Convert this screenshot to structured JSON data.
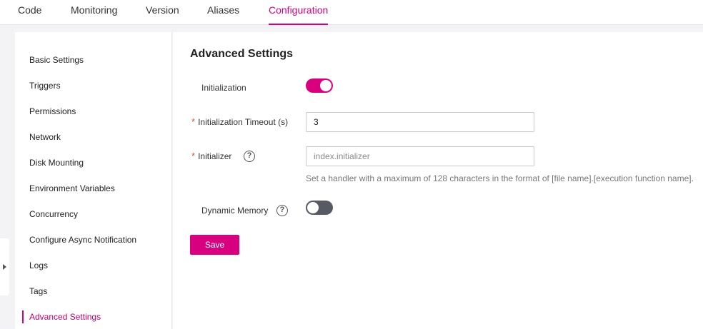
{
  "tabs": [
    {
      "label": "Code"
    },
    {
      "label": "Monitoring"
    },
    {
      "label": "Version"
    },
    {
      "label": "Aliases"
    },
    {
      "label": "Configuration"
    }
  ],
  "active_tab": "Configuration",
  "sidebar": {
    "items": [
      {
        "label": "Basic Settings"
      },
      {
        "label": "Triggers"
      },
      {
        "label": "Permissions"
      },
      {
        "label": "Network"
      },
      {
        "label": "Disk Mounting"
      },
      {
        "label": "Environment Variables"
      },
      {
        "label": "Concurrency"
      },
      {
        "label": "Configure Async Notification"
      },
      {
        "label": "Logs"
      },
      {
        "label": "Tags"
      },
      {
        "label": "Advanced Settings"
      }
    ],
    "active": "Advanced Settings"
  },
  "main": {
    "title": "Advanced Settings",
    "initialization": {
      "label": "Initialization",
      "enabled": true
    },
    "timeout": {
      "label": "Initialization Timeout (s)",
      "required_mark": "*",
      "value": "3"
    },
    "initializer": {
      "label": "Initializer",
      "required_mark": "*",
      "placeholder": "index.initializer",
      "help_icon": "?",
      "hint": "Set a handler with a maximum of 128 characters in the format of [file name].[execution function name]."
    },
    "dynamic_memory": {
      "label": "Dynamic Memory",
      "help_icon": "?",
      "enabled": false
    },
    "save_label": "Save"
  },
  "colors": {
    "accent": "#d9007f",
    "toggle_off": "#555a63"
  }
}
